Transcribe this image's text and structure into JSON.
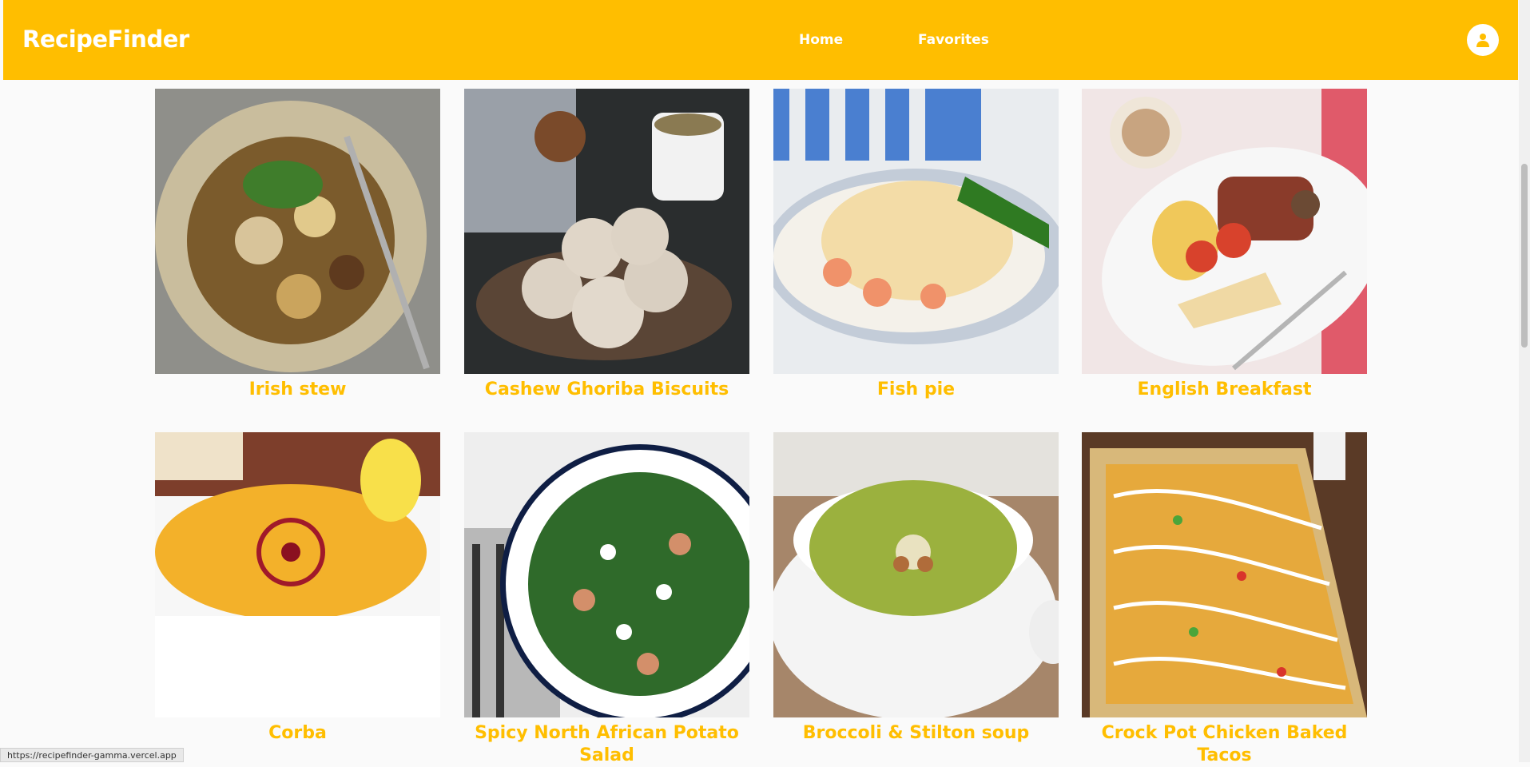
{
  "navbar": {
    "brand": "RecipeFinder",
    "links": [
      {
        "label": "Home"
      },
      {
        "label": "Favorites"
      }
    ],
    "colors": {
      "background": "#ffbe00",
      "text": "#ffffff"
    }
  },
  "recipes": [
    {
      "name": "Irish stew"
    },
    {
      "name": "Cashew Ghoriba Biscuits"
    },
    {
      "name": "Fish pie"
    },
    {
      "name": "English Breakfast"
    },
    {
      "name": "Corba"
    },
    {
      "name": "Spicy North African Potato Salad"
    },
    {
      "name": "Broccoli & Stilton soup"
    },
    {
      "name": "Crock Pot Chicken Baked Tacos"
    }
  ],
  "status_bar": {
    "url": "https://recipefinder-gamma.vercel.app"
  },
  "icons": {
    "account": "user-icon"
  }
}
